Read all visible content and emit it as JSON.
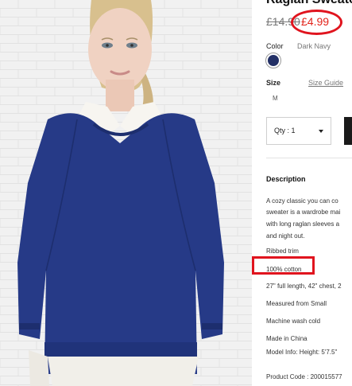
{
  "product": {
    "title": "Raglan Sweater",
    "old_price": "£14.90",
    "sale_price": "£4.99",
    "color_label": "Color",
    "color_value": "Dark Navy",
    "size_label": "Size",
    "size_guide_label": "Size Guide",
    "size_option": "M",
    "quantity_label": "Qty : 1"
  },
  "description": {
    "heading": "Description",
    "lines": [
      "A cozy classic you can co",
      "sweater is a wardrobe mai",
      "with long raglan sleeves a",
      "and night out.",
      "Ribbed trim",
      "100% cotton",
      "27\" full length, 42\" chest, 2",
      "Measured from Small",
      "Machine wash cold",
      "Made in China",
      "Model Info: Height: 5'7.5\"",
      "Product Code : 200015577"
    ]
  },
  "colors": {
    "swatch": "#233066",
    "sale": "#e2231a",
    "highlight": "#e0141e"
  }
}
